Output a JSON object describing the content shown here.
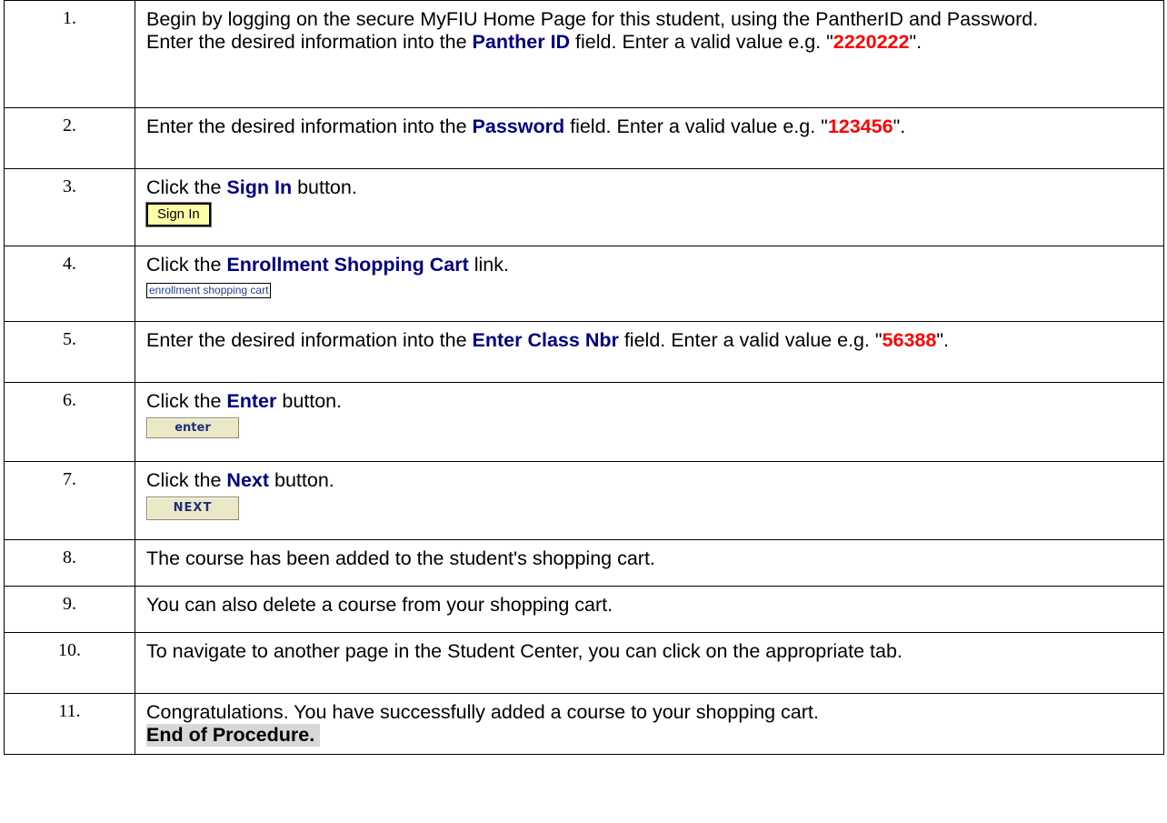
{
  "steps": [
    {
      "num": "1.",
      "line1": "Begin by logging on the secure MyFIU Home Page for this student, using the PantherID and Password.",
      "pre": "Enter the desired information into the ",
      "field": "Panther ID",
      "mid": " field. Enter a valid value e.g. \"",
      "value": "2220222",
      "post": "\"."
    },
    {
      "num": "2.",
      "pre": "Enter the desired information into the ",
      "field": "Password",
      "mid": " field. Enter a valid value e.g. \"",
      "value": "123456",
      "post": "\"."
    },
    {
      "num": "3.",
      "pre": "Click the ",
      "kw": "Sign In",
      "post": " button.",
      "button_label": "Sign In"
    },
    {
      "num": "4.",
      "pre": "Click the ",
      "kw": "Enrollment Shopping Cart",
      "post": " link.",
      "link_label": "enrollment shopping cart"
    },
    {
      "num": "5.",
      "pre": "Enter the desired information into the ",
      "field": "Enter Class Nbr",
      "mid": " field. Enter a valid value e.g. \"",
      "value": "56388",
      "post": "\"."
    },
    {
      "num": "6.",
      "pre": "Click the ",
      "kw": "Enter",
      "post": " button.",
      "button_label": "enter"
    },
    {
      "num": "7.",
      "pre": "Click the ",
      "kw": "Next",
      "post": " button.",
      "button_label": "NEXT"
    },
    {
      "num": "8.",
      "text": "The course has been added to the student's shopping cart."
    },
    {
      "num": "9.",
      "text": "You can also delete a course from your shopping cart."
    },
    {
      "num": "10.",
      "text": "To navigate to another page in the Student Center, you can click on the appropriate tab."
    },
    {
      "num": "11.",
      "text": "Congratulations. You have successfully added a course to your shopping cart.",
      "end": "End of Procedure."
    }
  ]
}
